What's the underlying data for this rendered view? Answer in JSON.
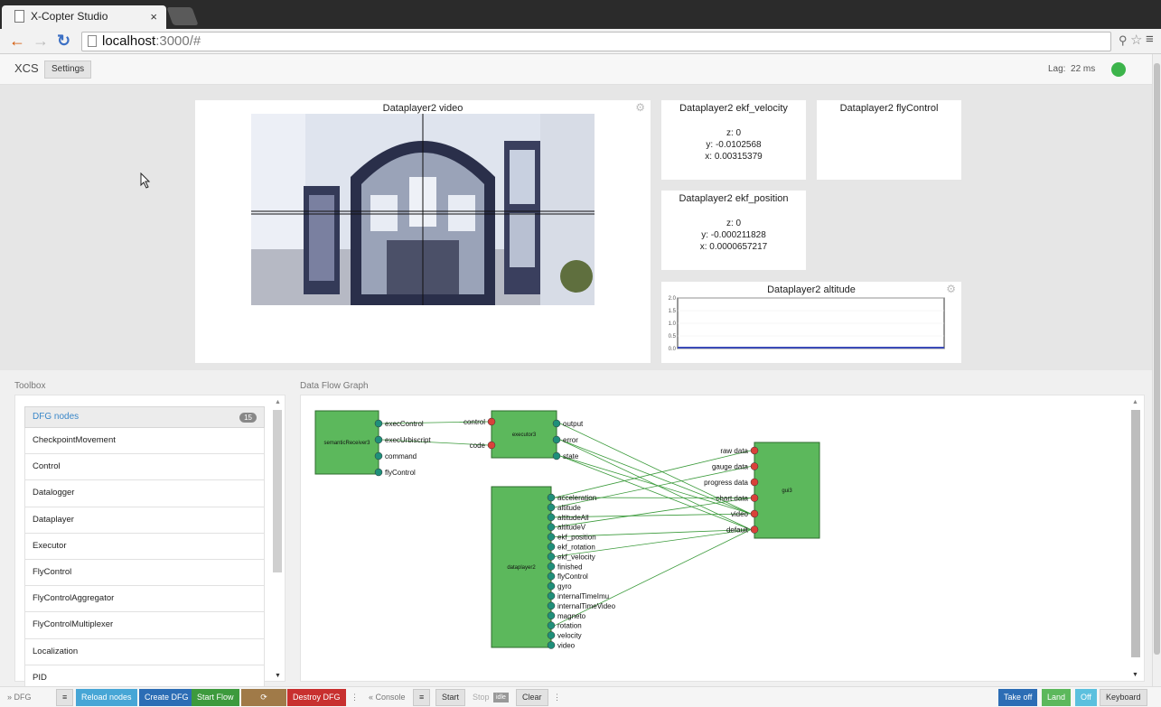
{
  "browser": {
    "tab_title": "X-Copter Studio",
    "tab_close": "×",
    "url_host": "localhost",
    "url_rest": ":3000/#",
    "back_icon": "arrow-left-icon",
    "forward_icon": "arrow-right-icon",
    "reload_icon": "reload-icon"
  },
  "header": {
    "brand": "XCS",
    "settings_label": "Settings",
    "lag_label": "Lag:",
    "lag_value": "22 ms",
    "status_color": "#3cb44b"
  },
  "panels": {
    "video": {
      "title": "Dataplayer2 video"
    },
    "ekf_velocity": {
      "title": "Dataplayer2 ekf_velocity",
      "z": "z: 0",
      "y": "y: -0.0102568",
      "x": "x: 0.00315379"
    },
    "fly_control": {
      "title": "Dataplayer2 flyControl"
    },
    "ekf_position": {
      "title": "Dataplayer2 ekf_position",
      "z": "z: 0",
      "y": "y: -0.000211828",
      "x": "x: 0.0000657217"
    },
    "altitude": {
      "title": "Dataplayer2 altitude"
    }
  },
  "chart_data": {
    "type": "line",
    "title": "Dataplayer2 altitude",
    "xlabel": "",
    "ylabel": "",
    "ylim": [
      0,
      2
    ],
    "yticks": [
      "2.0",
      "1.5",
      "1.0",
      "0.5",
      "0.0"
    ],
    "series": [
      {
        "values": [
          0,
          0,
          0,
          0,
          0,
          0,
          0,
          0,
          0,
          0
        ]
      }
    ],
    "line_color": "#3b4bb8"
  },
  "toolbox": {
    "label": "Toolbox",
    "header": "DFG nodes",
    "count": "15",
    "items": [
      "CheckpointMovement",
      "Control",
      "Datalogger",
      "Dataplayer",
      "Executor",
      "FlyControl",
      "FlyControlAggregator",
      "FlyControlMultiplexer",
      "Localization",
      "PID"
    ]
  },
  "dfg": {
    "label": "Data Flow Graph",
    "nodes": {
      "semantic": {
        "name": "semanticReceiver3",
        "outputs": [
          "execControl",
          "execUrbiscript",
          "command",
          "flyControl"
        ]
      },
      "executor": {
        "name": "executor3",
        "inputs": [
          "control",
          "code"
        ],
        "outputs": [
          "output",
          "error",
          "state"
        ]
      },
      "dataplayer": {
        "name": "dataplayer2",
        "outputs": [
          "acceleration",
          "altitude",
          "altitudeAll",
          "altitudeV",
          "ekf_position",
          "ekf_rotation",
          "ekf_velocity",
          "finished",
          "flyControl",
          "gyro",
          "internalTimeImu",
          "internalTimeVideo",
          "magneto",
          "rotation",
          "velocity",
          "video"
        ]
      },
      "gui": {
        "name": "gui3",
        "inputs": [
          "raw data",
          "gauge data",
          "progress data",
          "chart data",
          "video",
          "default"
        ]
      }
    }
  },
  "bottombar": {
    "dfg_toggle": "DFG",
    "menu_icon": "menu-icon",
    "reload_nodes": "Reload nodes",
    "create_dfg": "Create DFG",
    "start_flow": "Start Flow",
    "spinner_icon": "spinner-icon",
    "destroy_dfg": "Destroy DFG",
    "console_toggle": "Console",
    "start": "Start",
    "stop": "Stop",
    "idle": "idle",
    "clear": "Clear",
    "take_off": "Take off",
    "land": "Land",
    "off": "Off",
    "keyboard": "Keyboard"
  }
}
